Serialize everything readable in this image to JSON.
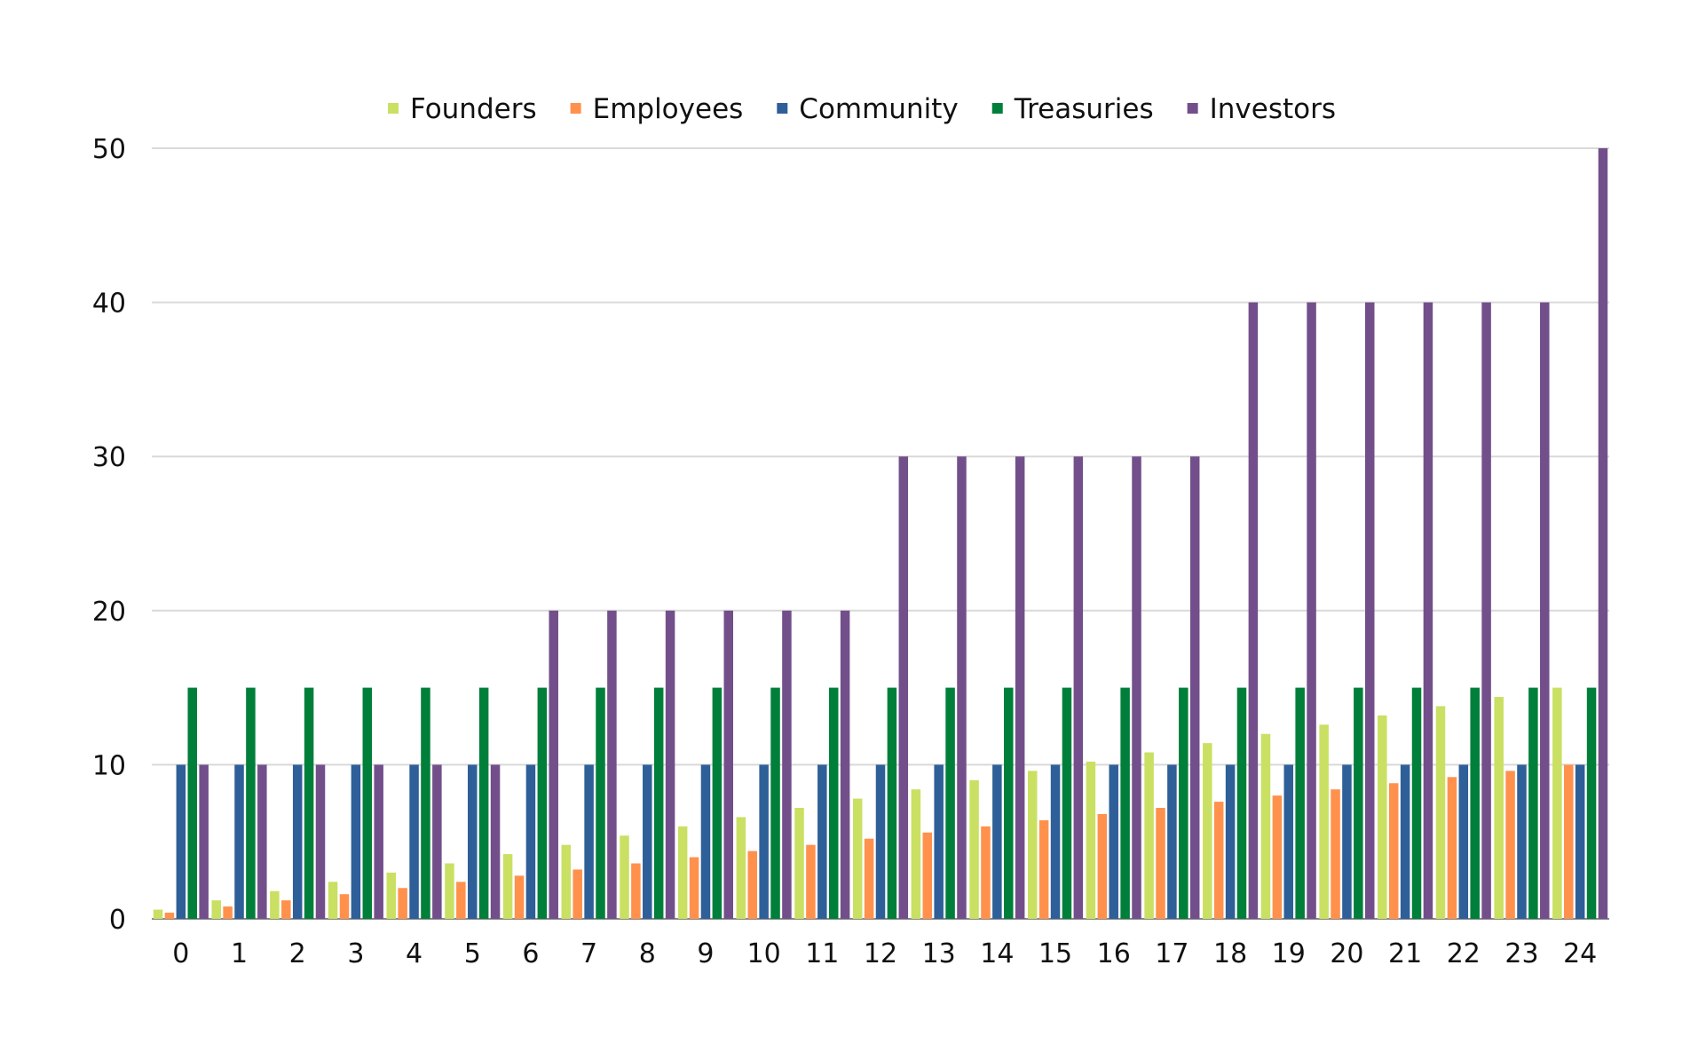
{
  "chart_data": {
    "type": "bar",
    "title": "",
    "xlabel": "",
    "ylabel": "",
    "ylim": [
      0,
      50
    ],
    "yticks": [
      0,
      10,
      20,
      30,
      40,
      50
    ],
    "grid": true,
    "legend_position": "top",
    "categories": [
      "0",
      "1",
      "2",
      "3",
      "4",
      "5",
      "6",
      "7",
      "8",
      "9",
      "10",
      "11",
      "12",
      "13",
      "14",
      "15",
      "16",
      "17",
      "18",
      "19",
      "20",
      "21",
      "22",
      "23",
      "24"
    ],
    "series": [
      {
        "name": "Founders",
        "color": "#c9e063",
        "values": [
          0.6,
          1.2,
          1.8,
          2.4,
          3.0,
          3.6,
          4.2,
          4.8,
          5.4,
          6.0,
          6.6,
          7.2,
          7.8,
          8.4,
          9.0,
          9.6,
          10.2,
          10.8,
          11.4,
          12.0,
          12.6,
          13.2,
          13.8,
          14.4,
          15.0
        ]
      },
      {
        "name": "Employees",
        "color": "#ff914d",
        "values": [
          0.4,
          0.8,
          1.2,
          1.6,
          2.0,
          2.4,
          2.8,
          3.2,
          3.6,
          4.0,
          4.4,
          4.8,
          5.2,
          5.6,
          6.0,
          6.4,
          6.8,
          7.2,
          7.6,
          8.0,
          8.4,
          8.8,
          9.2,
          9.6,
          10.0
        ]
      },
      {
        "name": "Community",
        "color": "#2e5f98",
        "values": [
          10,
          10,
          10,
          10,
          10,
          10,
          10,
          10,
          10,
          10,
          10,
          10,
          10,
          10,
          10,
          10,
          10,
          10,
          10,
          10,
          10,
          10,
          10,
          10,
          10
        ]
      },
      {
        "name": "Treasuries",
        "color": "#007f3a",
        "values": [
          15,
          15,
          15,
          15,
          15,
          15,
          15,
          15,
          15,
          15,
          15,
          15,
          15,
          15,
          15,
          15,
          15,
          15,
          15,
          15,
          15,
          15,
          15,
          15,
          15
        ]
      },
      {
        "name": "Investors",
        "color": "#724f8a",
        "values": [
          10,
          10,
          10,
          10,
          10,
          10,
          20,
          20,
          20,
          20,
          20,
          20,
          30,
          30,
          30,
          30,
          30,
          30,
          40,
          40,
          40,
          40,
          40,
          40,
          50
        ]
      }
    ]
  }
}
